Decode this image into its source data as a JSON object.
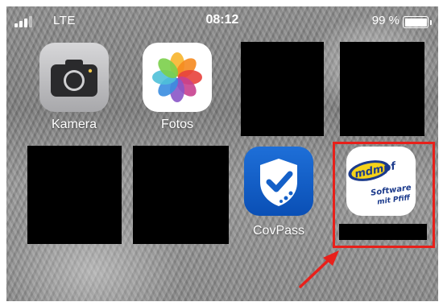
{
  "status_bar": {
    "network": "LTE",
    "time": "08:12",
    "battery": "99 %"
  },
  "apps": {
    "kamera": {
      "label": "Kamera",
      "icon": "camera-icon"
    },
    "fotos": {
      "label": "Fotos",
      "icon": "photos-flower-icon"
    },
    "covpass": {
      "label": "CovPass",
      "icon": "covpass-shield-icon"
    },
    "mdmpf": {
      "label": "",
      "icon": "mdmpf-logo-icon",
      "logo_text": [
        "mdmpf",
        "Software",
        "mit Pfiff"
      ]
    }
  },
  "colors": {
    "highlight": "#e8201a",
    "covpass_blue": "#0a4fb5",
    "mdmpf_blue": "#1b3a8c",
    "mdmpf_yellow": "#f5d21a"
  }
}
